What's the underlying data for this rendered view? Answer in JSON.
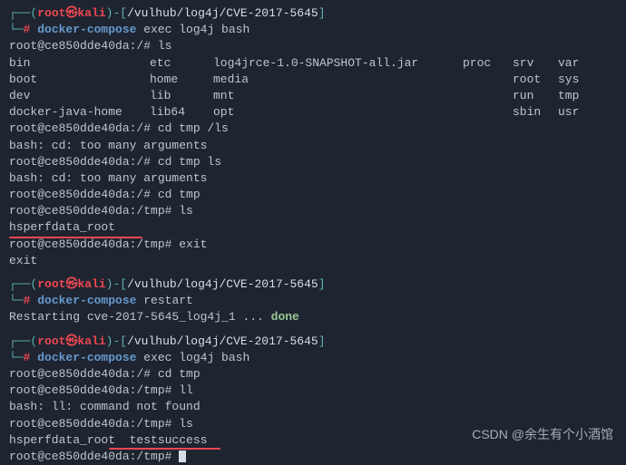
{
  "prompt1": {
    "open": "┌──(",
    "user": "root",
    "sep": "㉿",
    "host": "kali",
    "close": ")-[",
    "path": "/vulhub/log4j/CVE-2017-5645",
    "end": "]",
    "line2_prefix": "└─",
    "hash": "# ",
    "cmd": "docker-compose",
    "args": " exec log4j bash"
  },
  "session1": {
    "p1": "root@ce850dde40da:/# ",
    "ls": "ls",
    "cols": [
      [
        "bin",
        "etc",
        "log4jrce-1.0-SNAPSHOT-all.jar",
        "proc",
        "srv",
        "var"
      ],
      [
        "boot",
        "home",
        "media",
        "",
        "root",
        "sys"
      ],
      [
        "dev",
        "lib",
        "mnt",
        "",
        "run",
        "tmp"
      ],
      [
        "docker-java-home",
        "lib64",
        "opt",
        "",
        "sbin",
        "usr"
      ]
    ],
    "cd1": "cd tmp /ls",
    "err": "bash: cd: too many arguments",
    "cd2": "cd tmp ls",
    "cd3": "cd tmp",
    "p2": "root@ce850dde40da:/tmp# ",
    "ls2": "ls",
    "out1": "hsperfdata_root",
    "exit": "exit",
    "exit2": "exit"
  },
  "prompt2": {
    "cmd": "docker-compose",
    "args": " restart"
  },
  "restart": {
    "text": "Restarting cve-2017-5645_log4j_1 ... ",
    "done": "done"
  },
  "prompt3": {
    "cmd": "docker-compose",
    "args": " exec log4j bash"
  },
  "session2": {
    "p1": "root@ce850dde40da:/# ",
    "cd": "cd tmp",
    "p2": "root@ce850dde40da:/tmp# ",
    "ll": "ll",
    "err": "bash: ll: command not found",
    "ls": "ls",
    "out": "hsperfdata_root  testsuccess",
    "cursor": " "
  },
  "watermark": "CSDN @余生有个小酒馆"
}
